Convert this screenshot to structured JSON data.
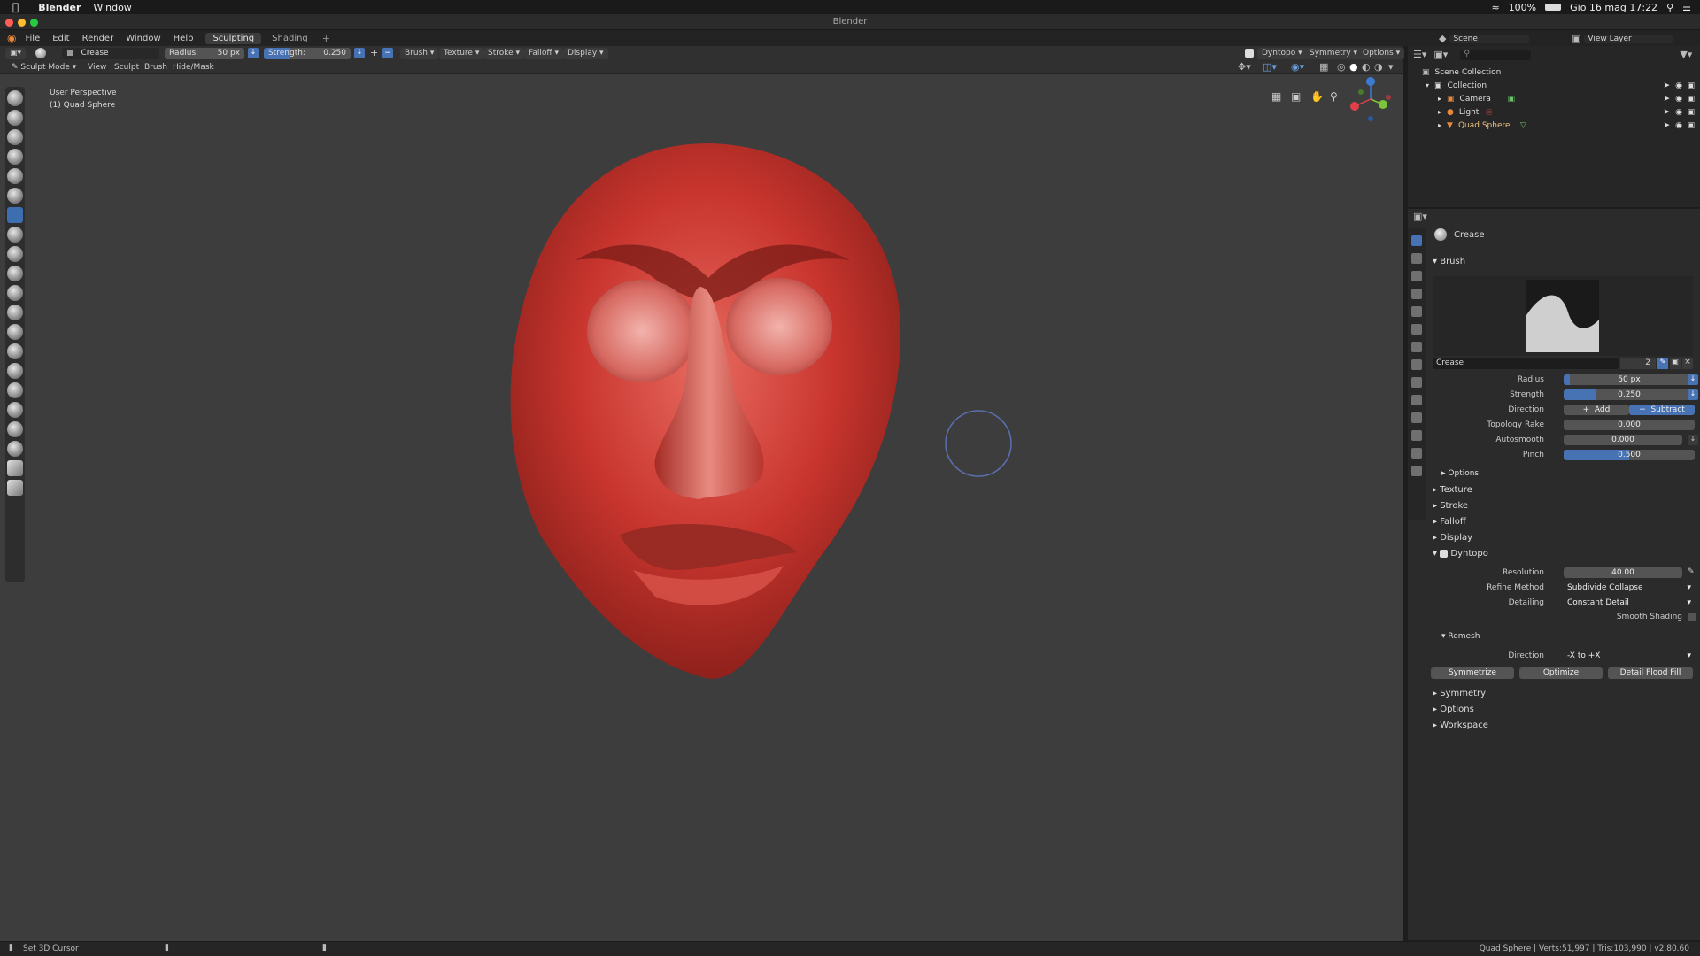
{
  "mac_menu": {
    "app": "Blender",
    "window": "Window",
    "battery": "100%",
    "datetime": "Gio 16 mag  17:22"
  },
  "title_bar": {
    "title": "Blender"
  },
  "top_menu": {
    "items": [
      "File",
      "Edit",
      "Render",
      "Window",
      "Help"
    ],
    "workspaces": [
      "Sculpting",
      "Shading"
    ],
    "add_tab": "+"
  },
  "tool_header": {
    "brush_name": "Crease",
    "radius_label": "Radius:",
    "radius_value": "50 px",
    "strength_label": "Strength:",
    "strength_value": "0.250",
    "menus": [
      "Brush",
      "Texture",
      "Stroke",
      "Falloff",
      "Display"
    ],
    "dyntopo": "Dyntopo",
    "symmetry": "Symmetry",
    "options": "Options"
  },
  "mode_header": {
    "mode": "Sculpt Mode",
    "menus": [
      "View",
      "Sculpt",
      "Brush",
      "Hide/Mask"
    ]
  },
  "viewport": {
    "perspective": "User Perspective",
    "object": "(1) Quad Sphere",
    "model_color": "#c0392b"
  },
  "scene_header": {
    "scene": "Scene",
    "view_layer": "View Layer"
  },
  "outliner": {
    "root": "Scene Collection",
    "collection": "Collection",
    "items": [
      {
        "name": "Camera",
        "icon": "camera-icon"
      },
      {
        "name": "Light",
        "icon": "light-icon"
      },
      {
        "name": "Quad Sphere",
        "icon": "mesh-icon"
      }
    ]
  },
  "properties": {
    "brush_title": "Crease",
    "brush_section": "Brush",
    "brush_field": "Crease",
    "brush_users": "2",
    "radius": {
      "label": "Radius",
      "value": "50 px",
      "fill": 0.05
    },
    "strength": {
      "label": "Strength",
      "value": "0.250",
      "fill": 0.25
    },
    "direction": {
      "label": "Direction",
      "add": "Add",
      "subtract": "Subtract"
    },
    "topology_rake": {
      "label": "Topology Rake",
      "value": "0.000"
    },
    "autosmooth": {
      "label": "Autosmooth",
      "value": "0.000"
    },
    "pinch": {
      "label": "Pinch",
      "value": "0.500",
      "fill": 0.5
    },
    "sections": [
      "Options",
      "Texture",
      "Stroke",
      "Falloff",
      "Display"
    ],
    "dyntopo": "Dyntopo",
    "resolution": {
      "label": "Resolution",
      "value": "40.00"
    },
    "refine": {
      "label": "Refine Method",
      "value": "Subdivide Collapse"
    },
    "detailing": {
      "label": "Detailing",
      "value": "Constant Detail"
    },
    "smooth_shading": "Smooth Shading",
    "remesh": "Remesh",
    "remesh_direction": {
      "label": "Direction",
      "value": "-X to +X"
    },
    "buttons": [
      "Symmetrize",
      "Optimize",
      "Detail Flood Fill"
    ],
    "bottom_sections": [
      "Symmetry",
      "Options",
      "Workspace"
    ]
  },
  "status_bar": {
    "left": "Set 3D Cursor",
    "right": "Quad Sphere | Verts:51,997 | Tris:103,990 | v2.80.60"
  }
}
